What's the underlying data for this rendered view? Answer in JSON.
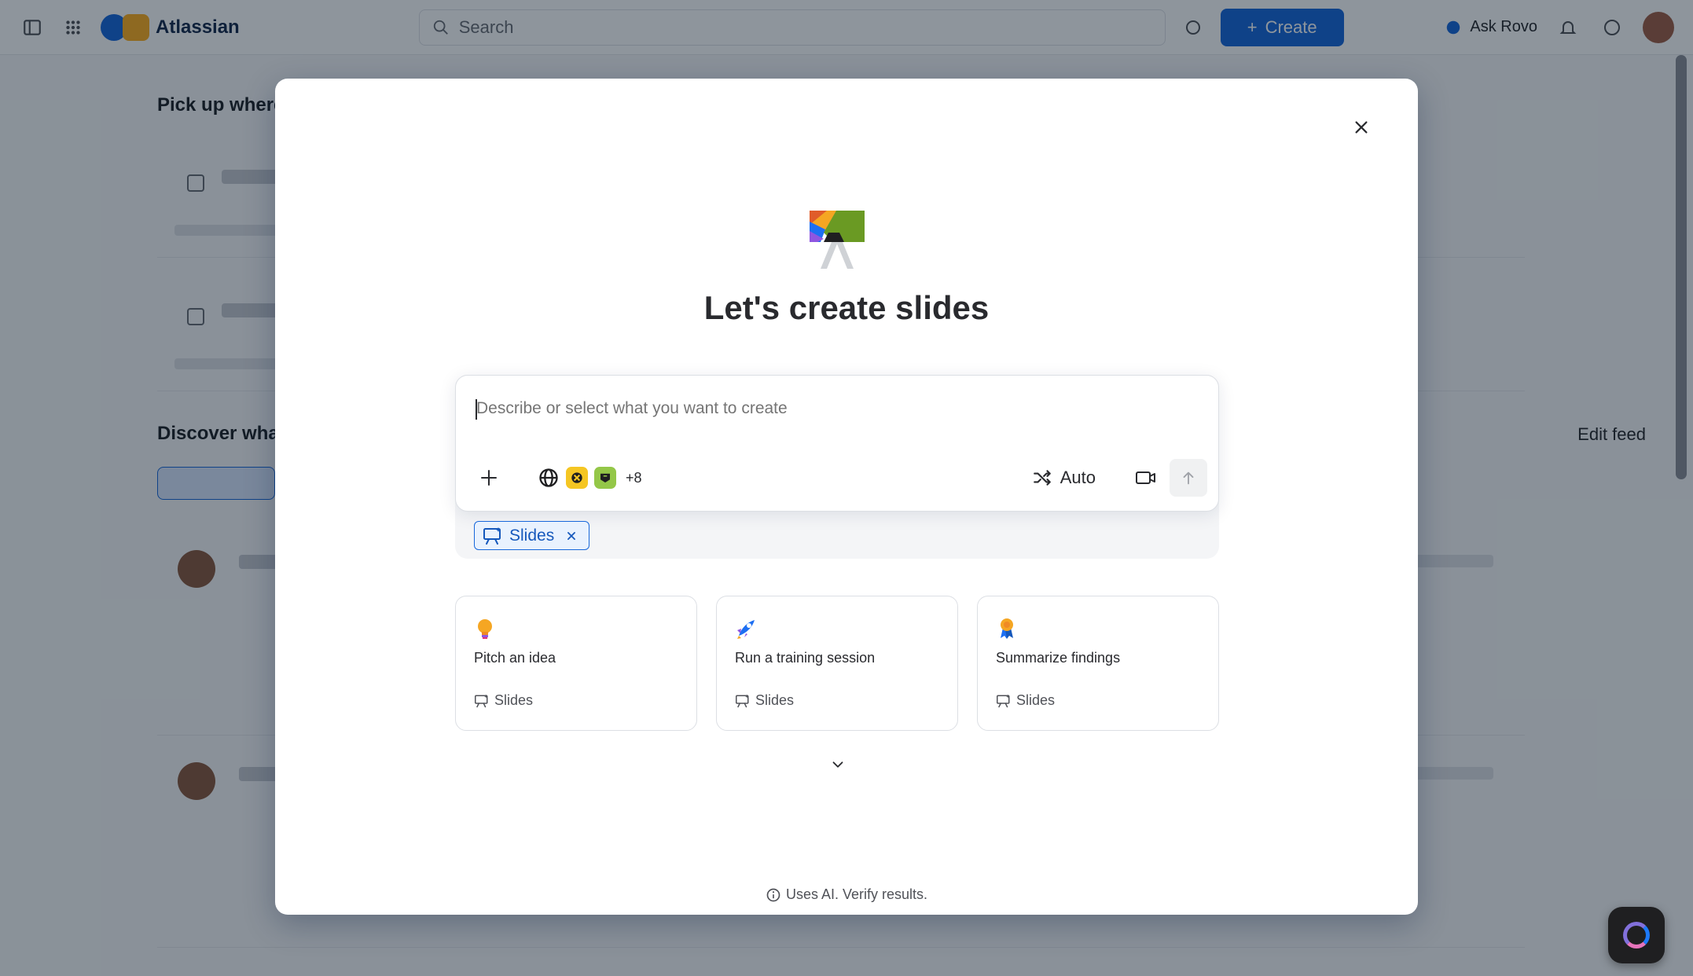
{
  "app": {
    "product_name": "Atlassian",
    "search_placeholder": "Search",
    "create_label": "Create",
    "ask_label": "Ask Rovo"
  },
  "background": {
    "section_title": "Pick up where",
    "discover_title": "Discover what",
    "edit_label": "Edit feed"
  },
  "modal": {
    "title": "Let's create slides",
    "close_icon": "close-icon",
    "composer": {
      "placeholder": "Describe or select what you want to create",
      "more_sources": "+8",
      "mode_label": "Auto"
    },
    "selected_chip": {
      "label": "Slides"
    },
    "suggestions": [
      {
        "emoji": "lightbulb",
        "title": "Pitch an idea",
        "type": "Slides"
      },
      {
        "emoji": "rocket",
        "title": "Run a training session",
        "type": "Slides"
      },
      {
        "emoji": "award-ribbon",
        "title": "Summarize findings",
        "type": "Slides"
      }
    ],
    "disclaimer": "Uses AI. Verify results."
  },
  "colors": {
    "accent": "#1868db",
    "chip_bg": "#e9f2fe",
    "overlay": "#051524"
  }
}
